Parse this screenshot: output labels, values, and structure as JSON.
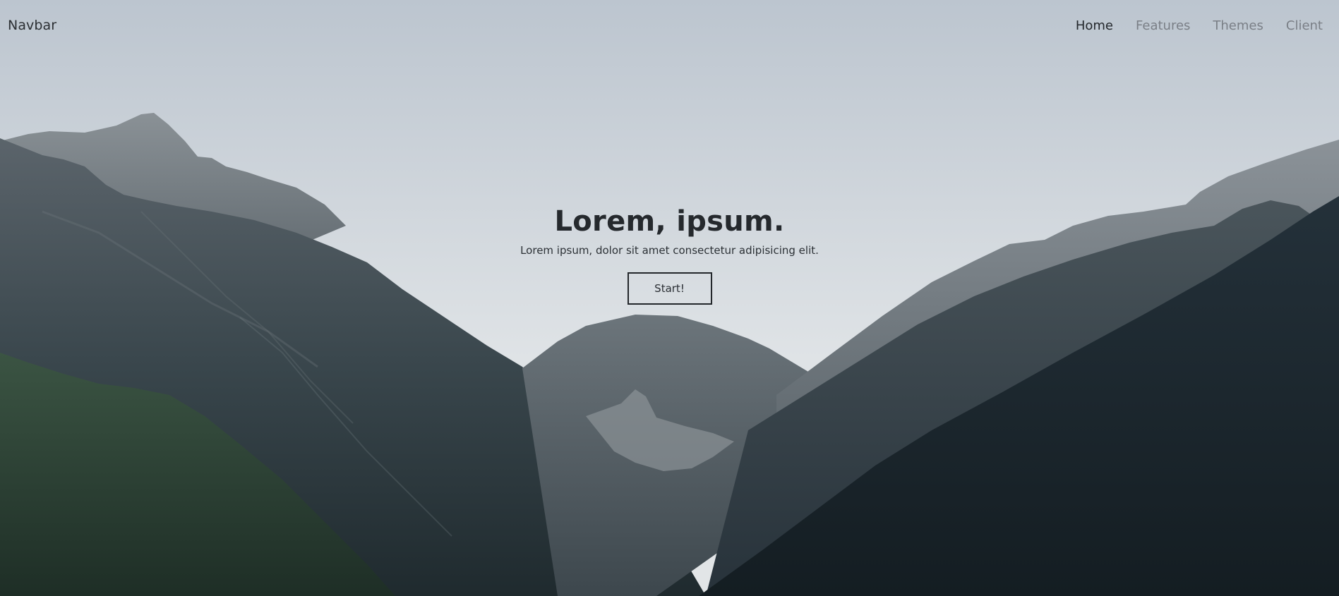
{
  "navbar": {
    "brand": "Navbar",
    "links": [
      {
        "label": "Home",
        "active": true
      },
      {
        "label": "Features",
        "active": false
      },
      {
        "label": "Themes",
        "active": false
      },
      {
        "label": "Client",
        "active": false
      }
    ]
  },
  "hero": {
    "title": "Lorem, ipsum.",
    "subtitle": "Lorem ipsum, dolor sit amet consectetur adipisicing elit.",
    "button_label": "Start!"
  },
  "colors": {
    "sky_top": "#bcc5cf",
    "sky_bottom": "#dfe3e6",
    "mountain_dark": "#1a252b",
    "forest_green": "#2f4836",
    "text_dark": "#25292d",
    "nav_muted": "#7a7f86"
  }
}
